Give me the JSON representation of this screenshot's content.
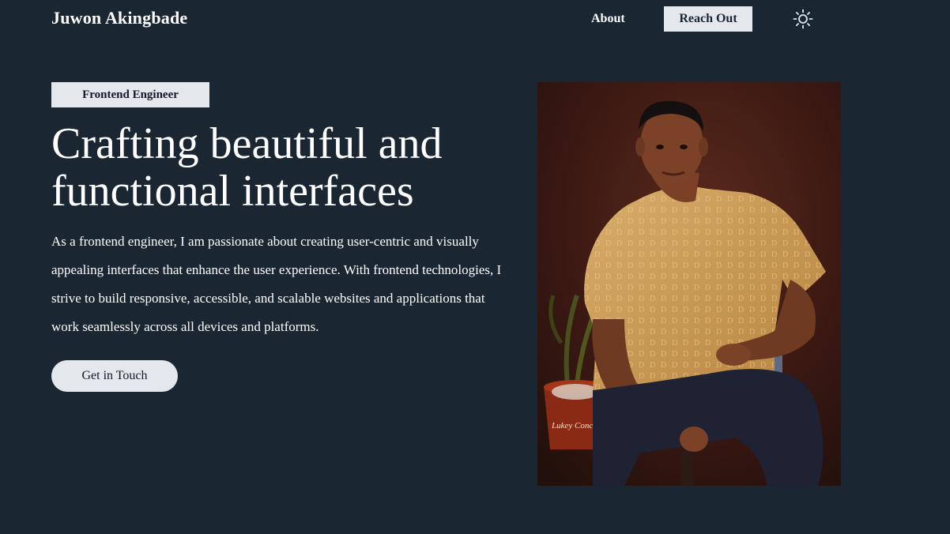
{
  "header": {
    "brand": "Juwon Akingbade",
    "nav": {
      "about_label": "About",
      "reach_out_label": "Reach Out"
    },
    "theme_icon": "sun-icon"
  },
  "hero": {
    "badge": "Frontend Engineer",
    "headline": "Crafting beautiful and functional interfaces",
    "description": "As a frontend engineer, I am passionate about creating user-centric and visually appealing interfaces that enhance the user experience. With frontend technologies, I strive to build responsive, accessible, and scalable websites and applications that work seamlessly across all devices and platforms.",
    "cta_label": "Get in Touch",
    "portrait_watermark": "Lukey Concept"
  },
  "colors": {
    "background": "#1b2633",
    "button_bg": "#e4e7ec",
    "text": "#ffffff",
    "portrait_backdrop": "#3a1812",
    "shirt": "#c99a55",
    "trousers": "#1e2232"
  }
}
